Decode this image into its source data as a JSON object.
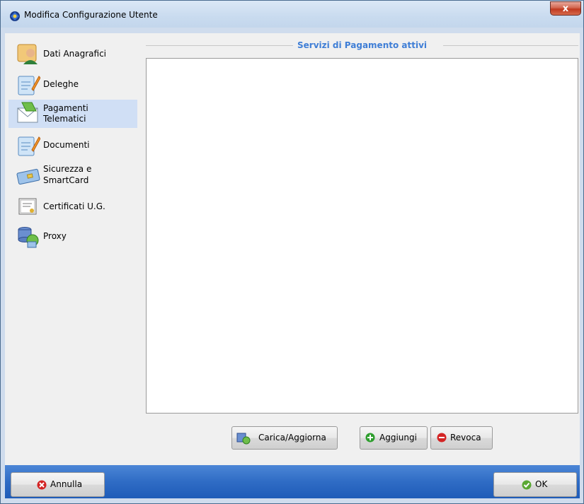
{
  "window": {
    "title": "Modifica Configurazione Utente",
    "close_label": "x"
  },
  "sidebar": {
    "items": [
      {
        "label": "Dati Anagrafici",
        "icon": "id-card-person-icon",
        "active": false
      },
      {
        "label": "Deleghe",
        "icon": "document-pencil-icon",
        "active": false
      },
      {
        "label1": "Pagamenti",
        "label2": "Telematici",
        "icon": "payment-envelope-icon",
        "active": true
      },
      {
        "label": "Documenti",
        "icon": "document-pencil-icon",
        "active": false
      },
      {
        "label1": "Sicurezza e",
        "label2": "SmartCard",
        "icon": "smartcard-icon",
        "active": false
      },
      {
        "label": "Certificati U.G.",
        "icon": "certificate-icon",
        "active": false
      },
      {
        "label": "Proxy",
        "icon": "network-proxy-icon",
        "active": false
      }
    ]
  },
  "main": {
    "group_title": "Servizi di Pagamento attivi",
    "buttons": {
      "reload": "Carica/Aggiorna",
      "add": "Aggiungi",
      "revoke": "Revoca"
    }
  },
  "footer": {
    "cancel": "Annulla",
    "ok": "OK"
  },
  "colors": {
    "legend": "#3f7ed6",
    "footer": "#2f6cc5",
    "active_item": "#d0dff5",
    "add_green": "#2e9e2e",
    "revoke_red": "#d32424"
  }
}
